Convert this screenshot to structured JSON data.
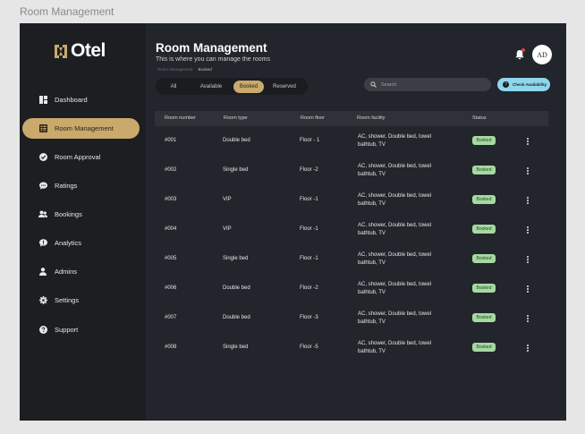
{
  "canvas_label": "Room Management",
  "brand": {
    "name": "Otel"
  },
  "sidebar": {
    "items": [
      {
        "label": "Dashboard",
        "icon": "dashboard-icon"
      },
      {
        "label": "Room Management",
        "icon": "room-list-icon",
        "active": true
      },
      {
        "label": "Room Approval",
        "icon": "check-circle-icon"
      },
      {
        "label": "Ratings",
        "icon": "chat-bubble-icon"
      },
      {
        "label": "Bookings",
        "icon": "people-icon"
      },
      {
        "label": "Analytics",
        "icon": "chat-alert-icon"
      },
      {
        "label": "Admins",
        "icon": "person-icon"
      },
      {
        "label": "Settings",
        "icon": "gear-icon"
      },
      {
        "label": "Support",
        "icon": "help-icon"
      }
    ]
  },
  "header": {
    "title": "Room Management",
    "subtitle": "This is where you can manage the rooms",
    "breadcrumb": [
      "Room Management",
      "Booked"
    ],
    "avatar_initials": "AD"
  },
  "filters": {
    "tabs": [
      "All",
      "Available",
      "Booked",
      "Reserved"
    ],
    "active": "Booked"
  },
  "search": {
    "placeholder": "Search"
  },
  "check_availability": {
    "label": "Check Availability"
  },
  "table": {
    "columns": [
      "Room number",
      "Room type",
      "Room floor",
      "Room facility",
      "Status"
    ],
    "rows": [
      {
        "number": "#001",
        "type": "Double bed",
        "floor": "Floor - 1",
        "facility": "AC, shower, Double bed, towel bathtub, TV",
        "status": "Booked"
      },
      {
        "number": "#002",
        "type": "Single bed",
        "floor": "Floor -2",
        "facility": "AC, shower, Double bed, towel bathtub, TV",
        "status": "Booked"
      },
      {
        "number": "#003",
        "type": "VIP",
        "floor": "Floor -1",
        "facility": "AC, shower, Double bed, towel bathtub, TV",
        "status": "Booked"
      },
      {
        "number": "#004",
        "type": "VIP",
        "floor": "Floor -1",
        "facility": "AC, shower, Double bed, towel bathtub, TV",
        "status": "Booked"
      },
      {
        "number": "#005",
        "type": "Single bed",
        "floor": "Floor -1",
        "facility": "AC, shower, Double bed, towel bathtub, TV",
        "status": "Booked"
      },
      {
        "number": "#006",
        "type": "Double bed",
        "floor": "Floor -2",
        "facility": "AC, shower, Double bed, towel bathtub, TV",
        "status": "Booked"
      },
      {
        "number": "#007",
        "type": "Double bed",
        "floor": "Floor -3",
        "facility": "AC, shower, Double bed, towel bathtub, TV",
        "status": "Booked"
      },
      {
        "number": "#008",
        "type": "Single bed",
        "floor": "Floor -5",
        "facility": "AC, shower, Double bed, towel bathtub, TV",
        "status": "Booked"
      }
    ]
  },
  "colors": {
    "accent_gold": "#c9a96c",
    "sidebar_bg": "#1c1e22",
    "main_bg": "#22252b",
    "badge_green": "#a6d9a2",
    "button_blue": "#8fd6ec",
    "notification_red": "#e0443c"
  }
}
